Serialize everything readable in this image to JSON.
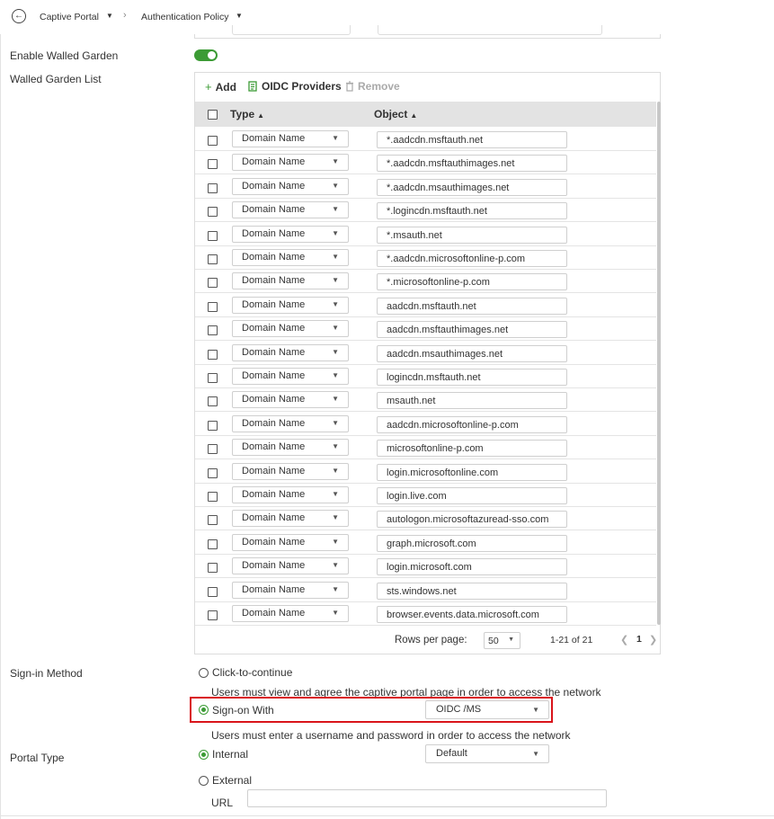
{
  "breadcrumb": {
    "item1": "Captive Portal",
    "item2": "Authentication Policy"
  },
  "walled_garden": {
    "enable_label": "Enable Walled Garden",
    "enabled": true,
    "list_label": "Walled Garden List",
    "toolbar": {
      "add_label": "Add",
      "oidc_label": "OIDC Providers",
      "remove_label": "Remove"
    },
    "columns": {
      "type": "Type",
      "object": "Object"
    },
    "rows": [
      {
        "type": "Domain Name",
        "object": "*.aadcdn.msftauth.net"
      },
      {
        "type": "Domain Name",
        "object": "*.aadcdn.msftauthimages.net"
      },
      {
        "type": "Domain Name",
        "object": "*.aadcdn.msauthimages.net"
      },
      {
        "type": "Domain Name",
        "object": "*.logincdn.msftauth.net"
      },
      {
        "type": "Domain Name",
        "object": "*.msauth.net"
      },
      {
        "type": "Domain Name",
        "object": "*.aadcdn.microsoftonline-p.com"
      },
      {
        "type": "Domain Name",
        "object": "*.microsoftonline-p.com"
      },
      {
        "type": "Domain Name",
        "object": "aadcdn.msftauth.net"
      },
      {
        "type": "Domain Name",
        "object": "aadcdn.msftauthimages.net"
      },
      {
        "type": "Domain Name",
        "object": "aadcdn.msauthimages.net"
      },
      {
        "type": "Domain Name",
        "object": "logincdn.msftauth.net"
      },
      {
        "type": "Domain Name",
        "object": "msauth.net"
      },
      {
        "type": "Domain Name",
        "object": "aadcdn.microsoftonline-p.com"
      },
      {
        "type": "Domain Name",
        "object": "microsoftonline-p.com"
      },
      {
        "type": "Domain Name",
        "object": "login.microsoftonline.com"
      },
      {
        "type": "Domain Name",
        "object": "login.live.com"
      },
      {
        "type": "Domain Name",
        "object": "autologon.microsoftazuread-sso.com"
      },
      {
        "type": "Domain Name",
        "object": "graph.microsoft.com"
      },
      {
        "type": "Domain Name",
        "object": "login.microsoft.com"
      },
      {
        "type": "Domain Name",
        "object": "sts.windows.net"
      },
      {
        "type": "Domain Name",
        "object": "browser.events.data.microsoft.com"
      }
    ],
    "pagination": {
      "rows_per_page_label": "Rows per page:",
      "rows_per_page_value": "50",
      "range": "1-21 of 21",
      "page": "1"
    }
  },
  "sign_in": {
    "label": "Sign-in Method",
    "click_to_continue_label": "Click-to-continue",
    "click_to_continue_desc": "Users must view and agree the captive portal page in order to access the network",
    "sign_on_label": "Sign-on With",
    "sign_on_value": "OIDC /MS",
    "sign_on_desc": "Users must enter a username and password in order to access the network",
    "selected": "sign_on"
  },
  "portal_type": {
    "label": "Portal Type",
    "internal_label": "Internal",
    "internal_value": "Default",
    "external_label": "External",
    "url_label": "URL",
    "url_value": "",
    "selected": "internal"
  },
  "colors": {
    "accent_green": "#3c9b35",
    "highlight_red": "#d9141b"
  }
}
